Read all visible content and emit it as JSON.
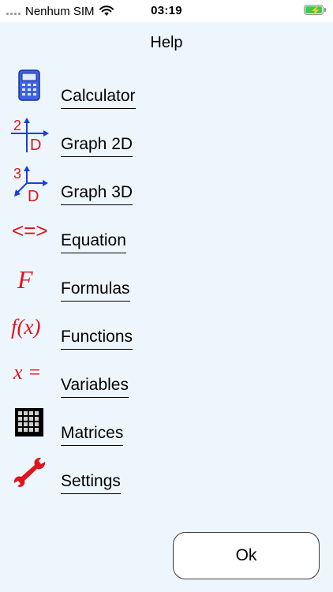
{
  "status_bar": {
    "carrier": "Nenhum SIM",
    "time": "03:19",
    "battery_color": "#3ec94b"
  },
  "header": {
    "title": "Help"
  },
  "menu": {
    "items": [
      {
        "label": "Calculator",
        "icon": "calculator-icon"
      },
      {
        "label": "Graph 2D",
        "icon": "graph-2d-icon"
      },
      {
        "label": "Graph 3D",
        "icon": "graph-3d-icon"
      },
      {
        "label": "Equation",
        "icon": "equation-icon"
      },
      {
        "label": "Formulas",
        "icon": "formulas-icon"
      },
      {
        "label": "Functions",
        "icon": "functions-icon"
      },
      {
        "label": "Variables",
        "icon": "variables-icon"
      },
      {
        "label": "Matrices",
        "icon": "matrices-icon"
      },
      {
        "label": "Settings",
        "icon": "settings-wrench-icon"
      }
    ],
    "icon_glyphs": {
      "graph2d_number": "2",
      "graph3d_number": "3",
      "graph_letter": "D",
      "equation_symbol": "<=>",
      "formulas_symbol": "F",
      "functions_symbol": "f(x)",
      "variables_symbol": "x ="
    },
    "accent_red": "#e0141e",
    "accent_blue": "#1c3fe0"
  },
  "footer": {
    "ok_label": "Ok"
  }
}
